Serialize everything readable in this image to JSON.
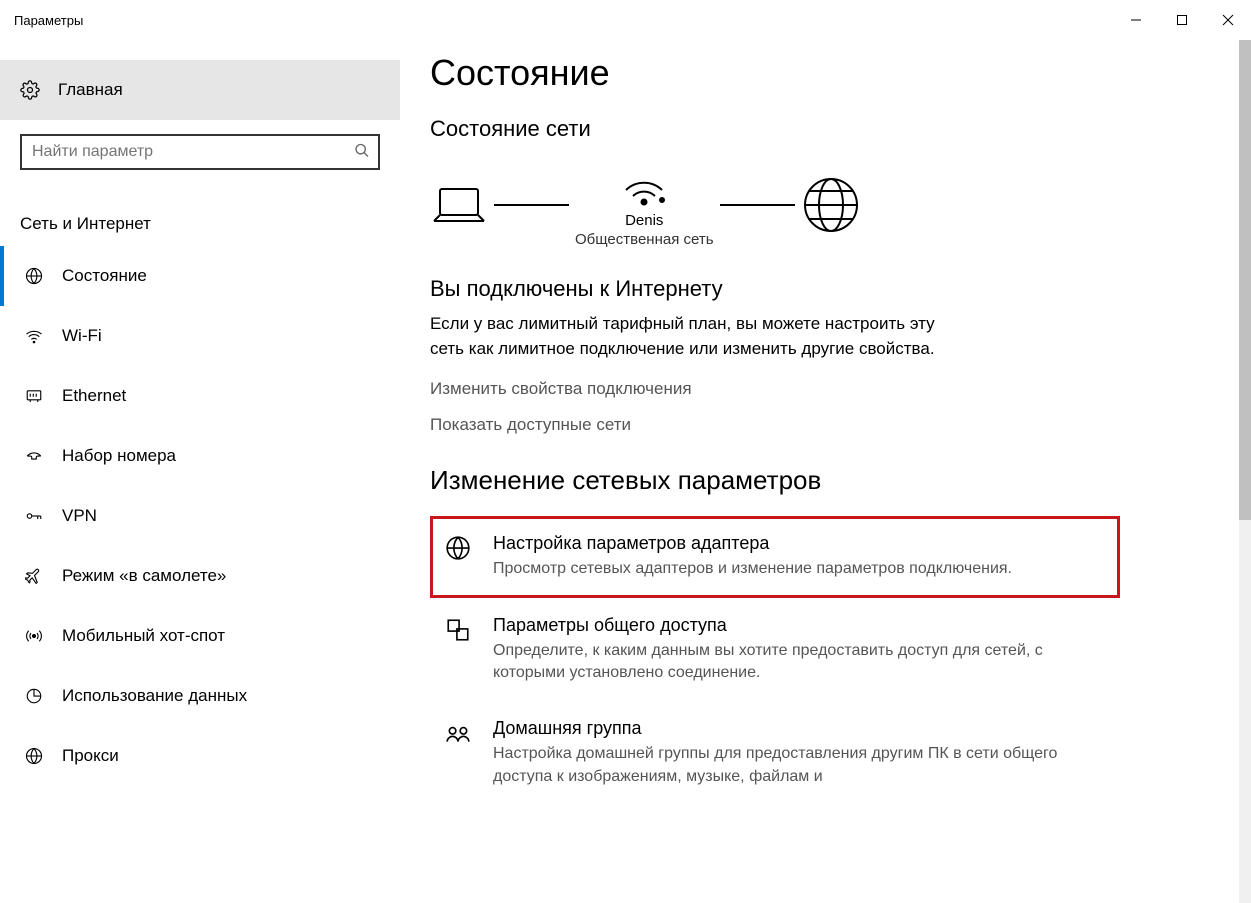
{
  "window": {
    "title": "Параметры"
  },
  "sidebar": {
    "home_label": "Главная",
    "search_placeholder": "Найти параметр",
    "section_title": "Сеть и Интернет",
    "items": [
      {
        "label": "Состояние",
        "icon": "status"
      },
      {
        "label": "Wi-Fi",
        "icon": "wifi"
      },
      {
        "label": "Ethernet",
        "icon": "ethernet"
      },
      {
        "label": "Набор номера",
        "icon": "dialup"
      },
      {
        "label": "VPN",
        "icon": "vpn"
      },
      {
        "label": "Режим «в самолете»",
        "icon": "airplane"
      },
      {
        "label": "Мобильный хот-спот",
        "icon": "hotspot"
      },
      {
        "label": "Использование данных",
        "icon": "data"
      },
      {
        "label": "Прокси",
        "icon": "proxy"
      }
    ]
  },
  "main": {
    "title": "Состояние",
    "network_status_heading": "Состояние сети",
    "diagram": {
      "network_name": "Denis",
      "network_type": "Общественная сеть"
    },
    "connected_heading": "Вы подключены к Интернету",
    "connected_desc": "Если у вас лимитный тарифный план, вы можете настроить эту сеть как лимитное подключение или изменить другие свойства.",
    "link_change_props": "Изменить свойства подключения",
    "link_show_networks": "Показать доступные сети",
    "change_settings_heading": "Изменение сетевых параметров",
    "options": [
      {
        "title": "Настройка параметров адаптера",
        "desc": "Просмотр сетевых адаптеров и изменение параметров подключения."
      },
      {
        "title": "Параметры общего доступа",
        "desc": "Определите, к каким данным вы хотите предоставить доступ для сетей, с которыми установлено соединение."
      },
      {
        "title": "Домашняя группа",
        "desc": "Настройка домашней группы для предоставления другим ПК в сети общего доступа к изображениям, музыке, файлам и"
      }
    ]
  }
}
